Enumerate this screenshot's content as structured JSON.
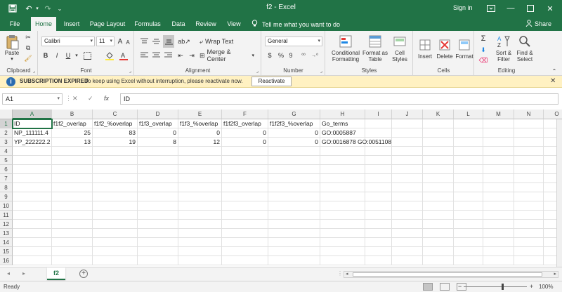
{
  "window": {
    "title": "f2 - Excel",
    "signin": "Sign in",
    "buttons": {
      "minimize": "🗕",
      "restore": "🗗",
      "close": "✕"
    }
  },
  "tabs": [
    {
      "label": "File"
    },
    {
      "label": "Home",
      "active": true
    },
    {
      "label": "Insert"
    },
    {
      "label": "Page Layout"
    },
    {
      "label": "Formulas"
    },
    {
      "label": "Data"
    },
    {
      "label": "Review"
    },
    {
      "label": "View"
    }
  ],
  "tell_me": "Tell me what you want to do",
  "share": "Share",
  "ribbon": {
    "clipboard": {
      "label": "Clipboard",
      "paste": "Paste"
    },
    "font": {
      "label": "Font",
      "name": "Calibri",
      "size": "11",
      "bold": "B",
      "italic": "I",
      "underline": "U"
    },
    "alignment": {
      "label": "Alignment",
      "wrap": "Wrap Text",
      "merge": "Merge & Center"
    },
    "number": {
      "label": "Number",
      "format": "General",
      "currency": "$",
      "percent": "%",
      "comma": "9"
    },
    "styles": {
      "label": "Styles",
      "conditional": [
        "Conditional",
        "Formatting"
      ],
      "format_as": [
        "Format as",
        "Table"
      ],
      "cell_styles": [
        "Cell",
        "Styles"
      ]
    },
    "cells": {
      "label": "Cells",
      "insert": "Insert",
      "delete": "Delete",
      "format": "Format"
    },
    "editing": {
      "label": "Editing",
      "sort": [
        "Sort &",
        "Filter"
      ],
      "find": [
        "Find &",
        "Select"
      ]
    }
  },
  "message_bar": {
    "header": "SUBSCRIPTION EXPIRED",
    "message": "To keep using Excel without interruption, please reactivate now.",
    "button": "Reactivate"
  },
  "formula_bar": {
    "name_box": "A1",
    "content": "ID"
  },
  "grid": {
    "columns": [
      "A",
      "B",
      "C",
      "D",
      "E",
      "F",
      "G",
      "H",
      "I",
      "J",
      "K",
      "L",
      "M",
      "N",
      "O"
    ],
    "rows": [
      "1",
      "2",
      "3",
      "4",
      "5",
      "6",
      "7",
      "8",
      "9",
      "10",
      "11",
      "12",
      "13",
      "14",
      "15",
      "16"
    ],
    "cells": [
      [
        "ID",
        "f1f2_overlap",
        "f1f2_%overlap",
        "f1f3_overlap",
        "f1f3_%overlap",
        "f1f2f3_overlap",
        "f1f2f3_%overlap",
        "Go_terms"
      ],
      [
        "NP_111111.4",
        "25",
        "83",
        "0",
        "0",
        "0",
        "0",
        "GO:0005887"
      ],
      [
        "YP_222222.2",
        "13",
        "19",
        "8",
        "12",
        "0",
        "0",
        "GO:0016878 GO:0051108"
      ]
    ]
  },
  "sheet": {
    "name": "f2"
  },
  "status": {
    "ready": "Ready",
    "zoom": "100%"
  }
}
